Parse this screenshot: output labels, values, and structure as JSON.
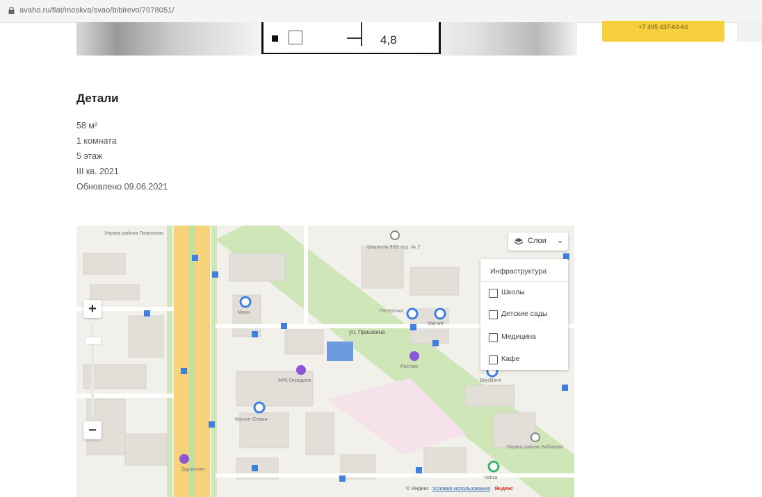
{
  "browser": {
    "url": "avaho.ru/flat/moskva/svao/bibirevo/7078051/"
  },
  "plan": {
    "dimension": "4,8"
  },
  "header": {
    "phone_label": "+7 495 437-64-64"
  },
  "details": {
    "title": "Детали",
    "items": [
      "58 м²",
      "1 комната",
      "5 этаж",
      "III кв. 2021",
      "Обновлено 09.06.2021"
    ]
  },
  "map": {
    "zoom_in": "+",
    "zoom_out": "−",
    "layers_button": "Слои",
    "layers_panel": {
      "header": "Инфраструктура",
      "options": [
        "Школы",
        "Детские сады",
        "Медицина",
        "Кафе"
      ]
    },
    "street": "ул. Пришвина",
    "labels": {
      "district_top": "Управа района Лианозово",
      "school": "Школа № 953, отд. № 2",
      "pyaterochka": "Пятёрочка",
      "magnit": "Магнит",
      "mini": "Мини",
      "afk": "АФК Отрадное",
      "magnit_family": "Магнит Семья",
      "rostics": "Ростикс",
      "vkusvill": "ВкусВилл",
      "district_bottom": "Управа района Бибирево",
      "chayka": "Чайка",
      "zdrav": "Здравсити"
    },
    "copyright": "© Яндекс",
    "terms": "Условия использования",
    "brand": "Яндекс",
    "colors": {
      "park": "#cfe6b8",
      "road_major": "#f6d27a",
      "building": "#e2dfd8",
      "poi_blue": "#3f7fe0",
      "poi_purple": "#8a57d6",
      "selected_building": "#6e9be0"
    }
  }
}
